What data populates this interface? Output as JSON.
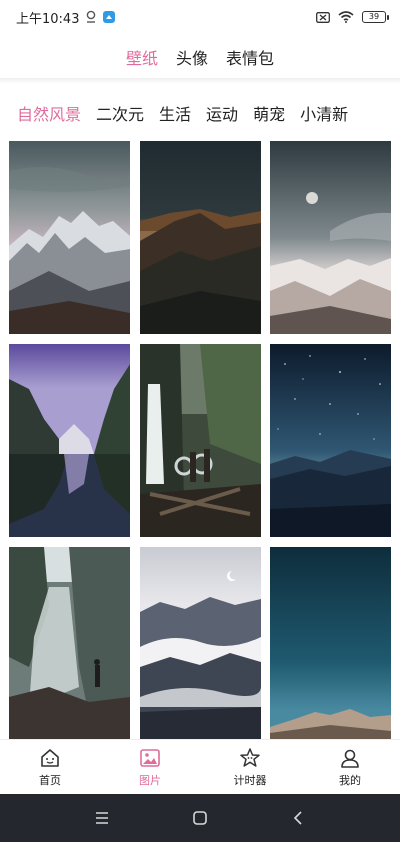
{
  "status_bar": {
    "time": "上午10:43",
    "battery": "39",
    "icons": [
      "location-icon",
      "app-notification-icon",
      "sim-icon",
      "wifi-icon",
      "battery-icon"
    ]
  },
  "top_tabs": [
    {
      "label": "壁纸",
      "active": true
    },
    {
      "label": "头像",
      "active": false
    },
    {
      "label": "表情包",
      "active": false
    }
  ],
  "sub_tabs": [
    {
      "label": "自然风景",
      "active": true
    },
    {
      "label": "二次元",
      "active": false
    },
    {
      "label": "生活",
      "active": false
    },
    {
      "label": "运动",
      "active": false
    },
    {
      "label": "萌宠",
      "active": false
    },
    {
      "label": "小清新",
      "active": false
    }
  ],
  "wallpapers": [
    {
      "subject": "snowy-mountains"
    },
    {
      "subject": "mountain-ridge-dusk"
    },
    {
      "subject": "moon-over-snow-peaks"
    },
    {
      "subject": "lake-reflection-purple-sky"
    },
    {
      "subject": "waterfall-with-people"
    },
    {
      "subject": "starry-sky-hills"
    },
    {
      "subject": "waterfall-canyon"
    },
    {
      "subject": "misty-forest-mountains"
    },
    {
      "subject": "teal-sky-rocky-hill"
    }
  ],
  "bottom_nav": [
    {
      "label": "首页",
      "icon": "home-icon",
      "active": false
    },
    {
      "label": "图片",
      "icon": "image-icon",
      "active": true
    },
    {
      "label": "计时器",
      "icon": "star-timer-icon",
      "active": false
    },
    {
      "label": "我的",
      "icon": "user-icon",
      "active": false
    }
  ],
  "colors": {
    "accent": "#e06c9c",
    "text": "#222222",
    "system_nav_bg": "#25272f"
  }
}
